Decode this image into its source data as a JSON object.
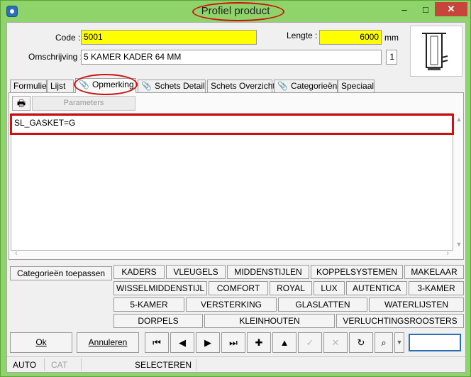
{
  "window": {
    "title": "Profiel product",
    "controls": {
      "minimize": "–",
      "maximize": "□",
      "close": "✕"
    }
  },
  "form": {
    "code_label": "Code :",
    "code_value": "5001",
    "lengte_label": "Lengte :",
    "lengte_value": "6000",
    "lengte_unit": "mm",
    "omschrijving_label": "Omschrijving :",
    "omschrijving_value": "5 KAMER KADER 64 MM",
    "count_value": "1"
  },
  "tabs": [
    {
      "label": "Formulier",
      "clip": false
    },
    {
      "label": "Lijst",
      "clip": false
    },
    {
      "label": "Opmerking",
      "clip": true,
      "active": true
    },
    {
      "label": "Schets Detail",
      "clip": true
    },
    {
      "label": "Schets Overzicht",
      "clip": false
    },
    {
      "label": "Categorieën",
      "clip": true
    },
    {
      "label": "Speciaal",
      "clip": false
    }
  ],
  "panel": {
    "print_icon": "printer-icon",
    "parameters_label": "Parameters",
    "memo_text": "SL_GASKET=G"
  },
  "categories": {
    "apply_label": "Categorieën toepassen",
    "row1": [
      "KADERS",
      "VLEUGELS",
      "MIDDENSTIJLEN",
      "KOPPELSYSTEMEN",
      "MAKELAAR"
    ],
    "row2": [
      "WISSELMIDDENSTIJL",
      "COMFORT",
      "ROYAL",
      "LUX",
      "AUTENTICA",
      "3-KAMER"
    ],
    "row3": [
      "5-KAMER",
      "VERSTERKING",
      "GLASLATTEN",
      "WATERLIJSTEN"
    ],
    "row4": [
      "DORPELS",
      "KLEINHOUTEN",
      "VERLUCHTINGSROOSTERS"
    ]
  },
  "actions": {
    "ok_label": "Ok",
    "cancel_label": "Annuleren",
    "nav": [
      {
        "name": "first-record-icon",
        "glyph": "⏮",
        "enabled": true
      },
      {
        "name": "previous-record-icon",
        "glyph": "◀",
        "enabled": true
      },
      {
        "name": "next-record-icon",
        "glyph": "▶",
        "enabled": true
      },
      {
        "name": "last-record-icon",
        "glyph": "⏭",
        "enabled": true
      },
      {
        "name": "add-record-icon",
        "glyph": "✚",
        "enabled": true
      },
      {
        "name": "edit-record-icon",
        "glyph": "▲",
        "enabled": true
      },
      {
        "name": "confirm-icon",
        "glyph": "✓",
        "enabled": false
      },
      {
        "name": "cancel-edit-icon",
        "glyph": "✕",
        "enabled": false
      },
      {
        "name": "refresh-icon",
        "glyph": "↻",
        "enabled": true
      },
      {
        "name": "binoculars-icon",
        "glyph": "⌕",
        "enabled": true
      }
    ],
    "search_value": ""
  },
  "status": {
    "mode_auto": "AUTO",
    "mode_cat": "CAT",
    "mode_select": "SELECTEREN"
  },
  "colors": {
    "window_frame": "#8fd46a",
    "highlight_field": "#ffff00",
    "annotation_red": "#d01010"
  }
}
